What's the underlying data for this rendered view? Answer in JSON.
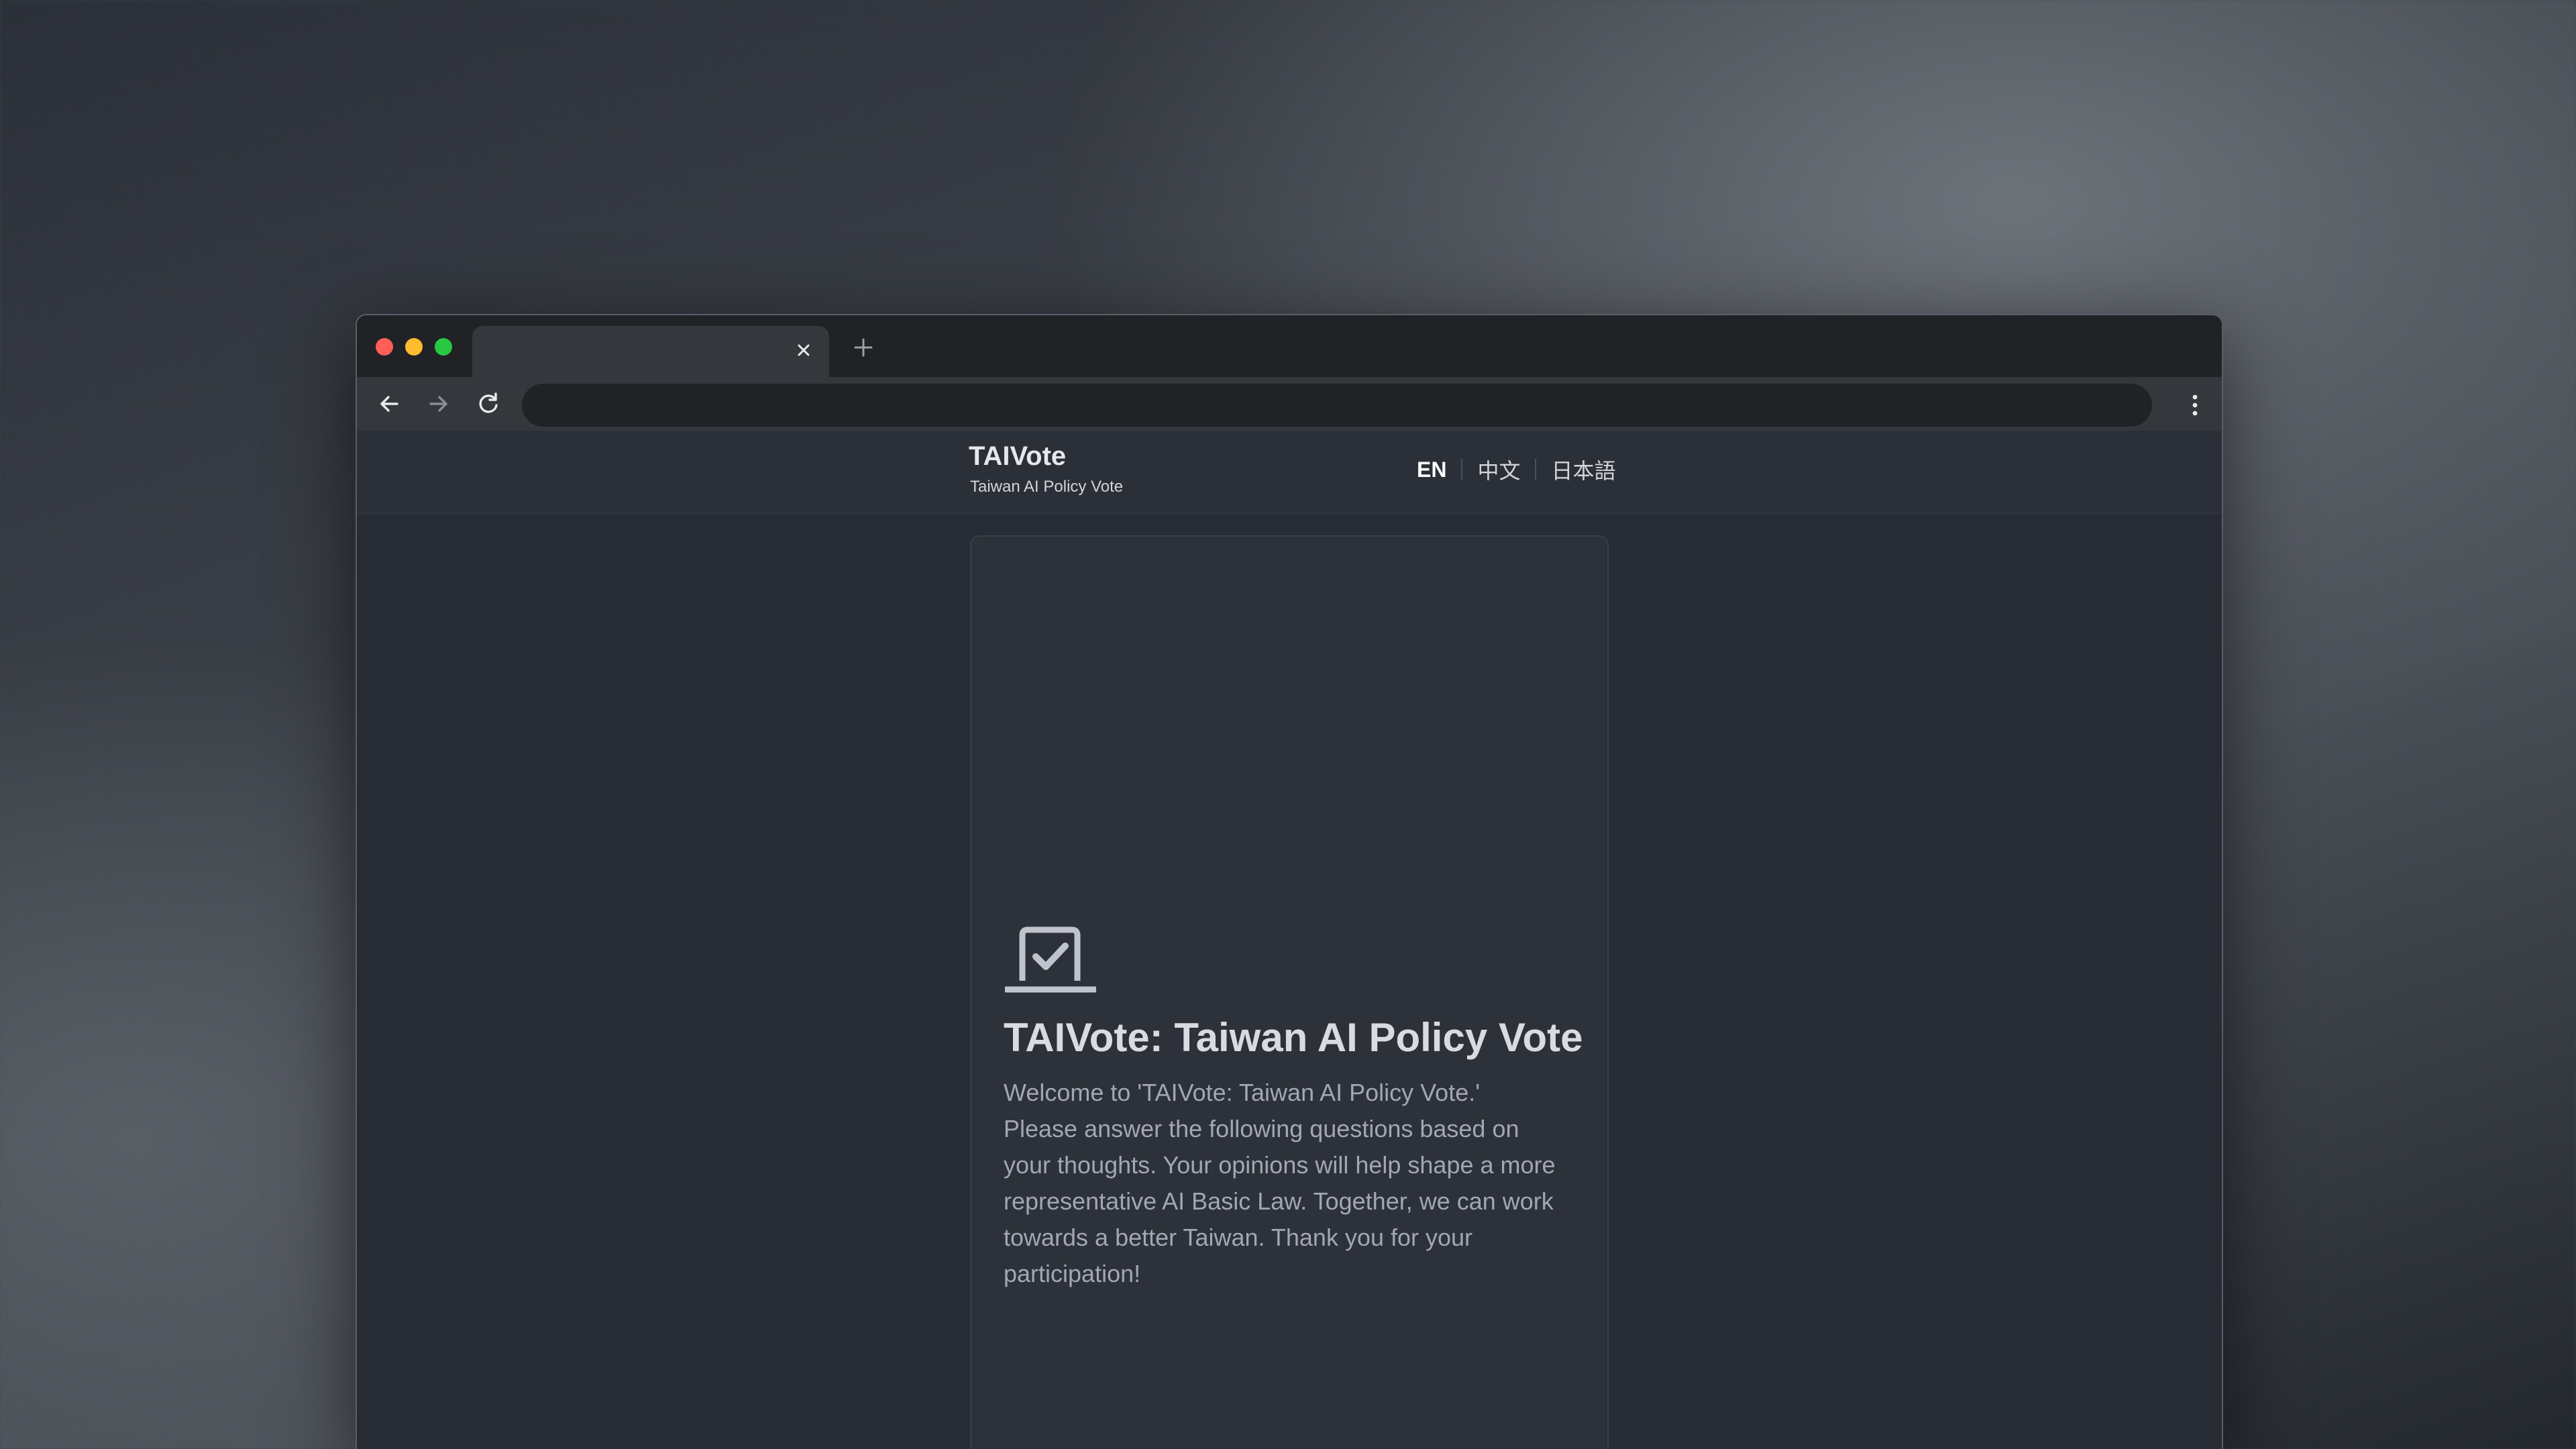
{
  "browser": {
    "tab": {
      "title": "",
      "close_icon": "close-icon"
    },
    "new_tab_icon": "plus-icon",
    "nav": {
      "back_icon": "arrow-left-icon",
      "forward_icon": "arrow-right-icon",
      "reload_icon": "reload-icon",
      "menu_icon": "kebab-menu-icon"
    },
    "address": {
      "url": ""
    }
  },
  "site": {
    "title": "TAIVote",
    "subtitle": "Taiwan AI Policy Vote",
    "languages": [
      {
        "label": "EN",
        "active": true
      },
      {
        "label": "中文",
        "active": false
      },
      {
        "label": "日本語",
        "active": false
      }
    ]
  },
  "card": {
    "icon": "ballot-box-check-icon",
    "title": "TAIVote: Taiwan AI Policy Vote",
    "body": "Welcome to 'TAIVote: Taiwan AI Policy Vote.' Please answer the following questions based on your thoughts. Your opinions will help shape a more representative AI Basic Law. Together, we can work towards a better Taiwan. Thank you for your participation!"
  },
  "colors": {
    "page_bg": "#272b34",
    "card_bg": "#2d3139",
    "title_text": "#d8dbe0",
    "body_text": "#a2a7b1"
  }
}
